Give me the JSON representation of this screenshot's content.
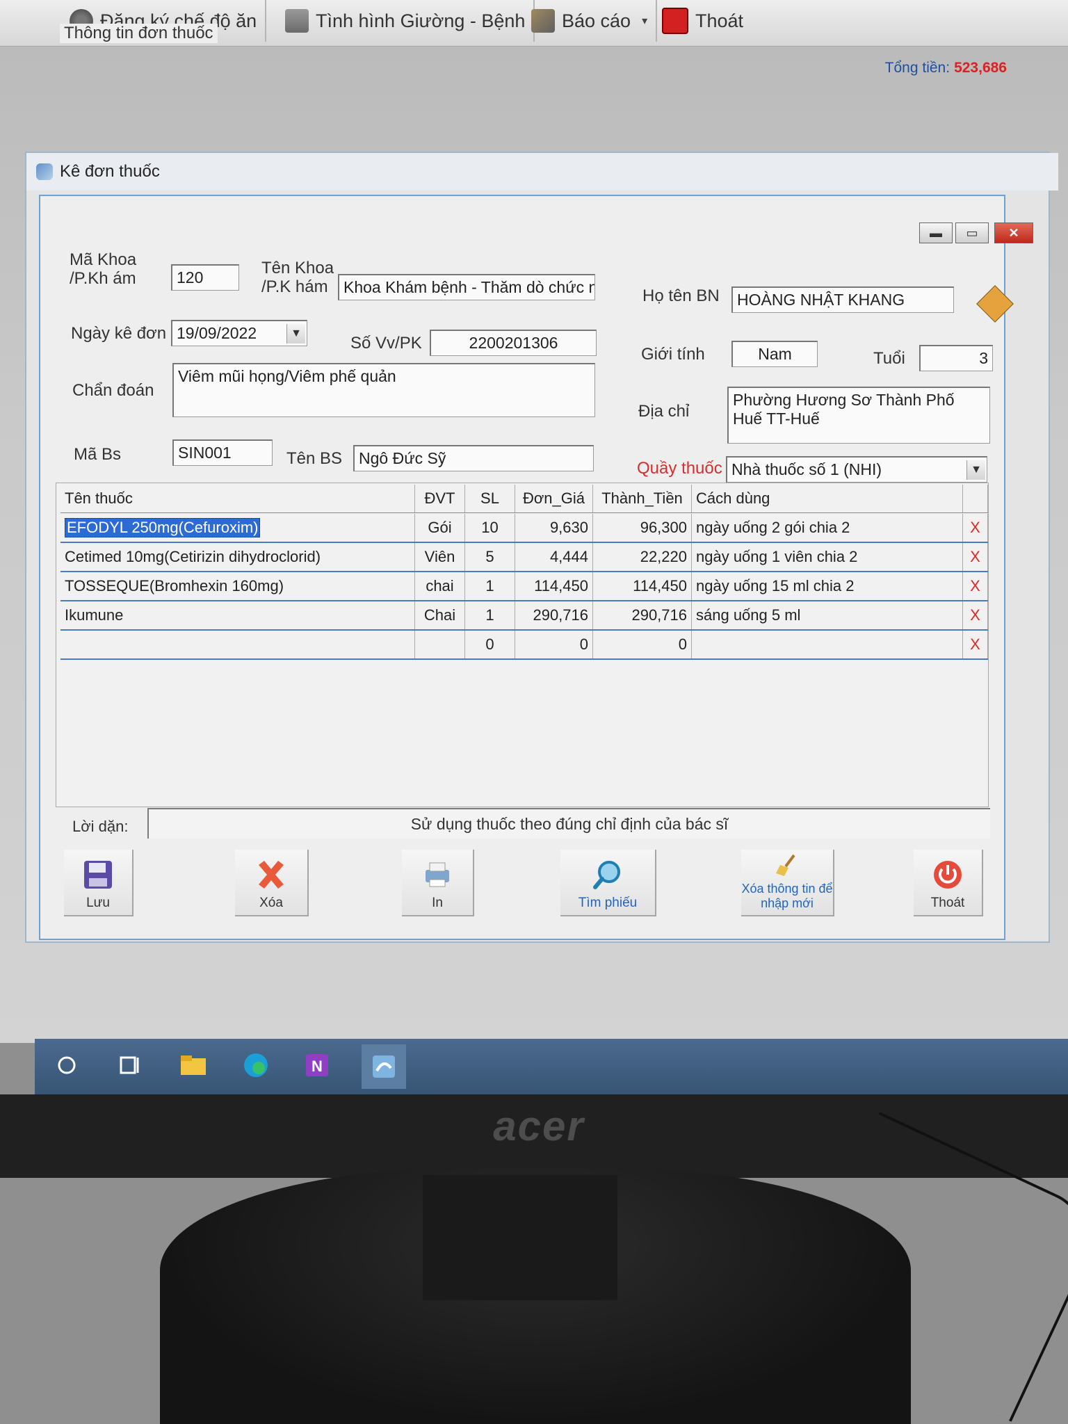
{
  "menubar": {
    "items": [
      {
        "label": "Đăng ký chế độ ăn",
        "icon": "diet-icon"
      },
      {
        "label": "Tình hình Giường - Bệnh",
        "icon": "bed-icon"
      },
      {
        "label": "Báo cáo",
        "icon": "report-icon"
      },
      {
        "label": "Thoát",
        "icon": "exit-icon"
      }
    ]
  },
  "window": {
    "title": "Kê đơn thuốc"
  },
  "info": {
    "legend": "Thông tin đơn thuốc",
    "total_label": "Tổng tiền:",
    "total_value": "523,686",
    "ma_khoa_label": "Mã Khoa /P.Kh ám",
    "ma_khoa": "120",
    "ten_khoa_label": "Tên Khoa /P.K hám",
    "ten_khoa": "Khoa Khám bệnh - Thăm dò chức n",
    "ho_ten_label": "Họ tên BN",
    "ho_ten": "HOÀNG NHẬT KHANG",
    "ngay_ke_don_label": "Ngày kê đơn",
    "ngay_ke_don": "19/09/2022",
    "so_vv_label": "Số Vv/PK",
    "so_vv": "2200201306",
    "gioi_tinh_label": "Giới tính",
    "gioi_tinh": "Nam",
    "tuoi_label": "Tuổi",
    "tuoi": "3",
    "chan_doan_label": "Chẩn đoán",
    "chan_doan": "Viêm mũi họng/Viêm phế quản",
    "dia_chi_label": "Địa chỉ",
    "dia_chi": "Phường Hương Sơ Thành Phố Huế TT-Huế",
    "ma_bs_label": "Mã Bs",
    "ma_bs": "SIN001",
    "ten_bs_label": "Tên BS",
    "ten_bs": "Ngô Đức Sỹ",
    "quay_thuoc_label": "Quầy thuốc",
    "quay_thuoc": "Nhà thuốc số 1 (NHI)"
  },
  "grid": {
    "headers": [
      "Tên thuốc",
      "ĐVT",
      "SL",
      "Đơn_Giá",
      "Thành_Tiền",
      "Cách dùng"
    ],
    "rows": [
      {
        "name": "EFODYL 250mg(Cefuroxim)",
        "unit": "Gói",
        "qty": "10",
        "price": "9,630",
        "amount": "96,300",
        "usage": "ngày uống 2 gói chia 2",
        "del": "X"
      },
      {
        "name": "Cetimed 10mg(Cetirizin dihydroclorid)",
        "unit": "Viên",
        "qty": "5",
        "price": "4,444",
        "amount": "22,220",
        "usage": "ngày uống 1 viên chia 2",
        "del": "X"
      },
      {
        "name": "TOSSEQUE(Bromhexin 160mg)",
        "unit": "chai",
        "qty": "1",
        "price": "114,450",
        "amount": "114,450",
        "usage": "ngày uống 15 ml chia 2",
        "del": "X"
      },
      {
        "name": "Ikumune",
        "unit": "Chai",
        "qty": "1",
        "price": "290,716",
        "amount": "290,716",
        "usage": "sáng uống 5 ml",
        "del": "X"
      },
      {
        "name": "",
        "unit": "",
        "qty": "0",
        "price": "0",
        "amount": "0",
        "usage": "",
        "del": "X"
      }
    ]
  },
  "note": {
    "label": "Lời dặn:",
    "value": "Sử dụng thuốc theo đúng chỉ định của bác sĩ"
  },
  "toolbar": {
    "save": "Lưu",
    "delete": "Xóa",
    "print": "In",
    "search": "Tìm phiếu",
    "clear": "Xóa thông tin để nhập mới",
    "exit": "Thoát"
  },
  "monitor": {
    "brand": "acer"
  },
  "colors": {
    "accent": "#2d6bd3",
    "total": "#e02020",
    "delete_x": "#e52525"
  }
}
